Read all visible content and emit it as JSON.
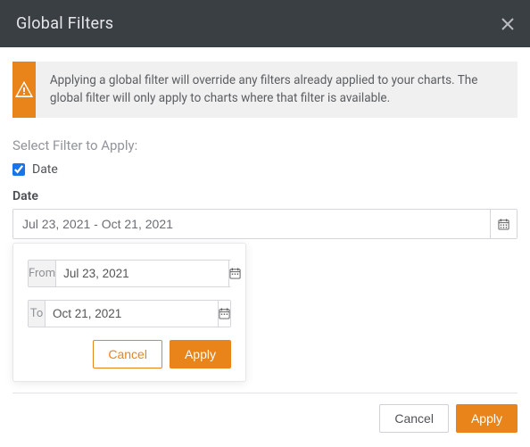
{
  "header": {
    "title": "Global Filters"
  },
  "alert": {
    "message": "Applying a global filter will override any filters already applied to your charts. The global filter will only apply to charts where that filter is available."
  },
  "select_label": "Select Filter to Apply:",
  "filters": {
    "date": {
      "label": "Date",
      "checked": true
    }
  },
  "date_section": {
    "label": "Date",
    "range_display": "Jul 23, 2021 - Oct 21, 2021"
  },
  "popover": {
    "from_label": "From",
    "from_value": "Jul 23, 2021",
    "to_label": "To",
    "to_value": "Oct 21, 2021",
    "cancel_label": "Cancel",
    "apply_label": "Apply"
  },
  "footer": {
    "cancel_label": "Cancel",
    "apply_label": "Apply"
  }
}
